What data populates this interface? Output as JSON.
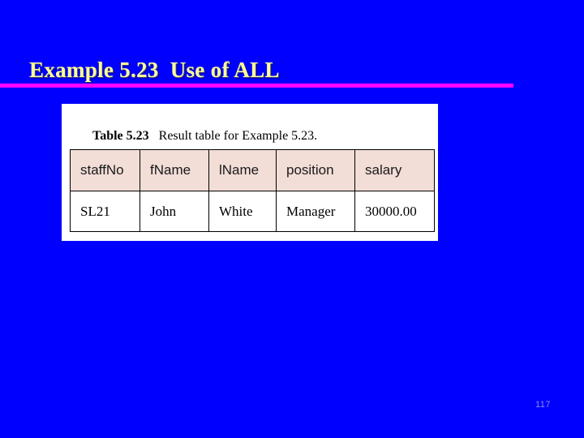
{
  "slide": {
    "background_color": "#0000FF",
    "title": "Example 5.23  Use of ALL",
    "title_color": "#FFFF99",
    "rule_color": "#FF00FF",
    "page_number": "117"
  },
  "table_card": {
    "caption_label": "Table 5.23",
    "caption_text": "   Result table for Example 5.23.",
    "header_background": "#F2DDD7",
    "body_background": "#FFFFFF",
    "columns": [
      {
        "key": "staffNo",
        "label": "staffNo"
      },
      {
        "key": "fName",
        "label": "fName"
      },
      {
        "key": "lName",
        "label": "lName"
      },
      {
        "key": "position",
        "label": "position"
      },
      {
        "key": "salary",
        "label": "salary"
      }
    ],
    "rows": [
      {
        "staffNo": "SL21",
        "fName": "John",
        "lName": "White",
        "position": "Manager",
        "salary": "30000.00"
      }
    ]
  }
}
